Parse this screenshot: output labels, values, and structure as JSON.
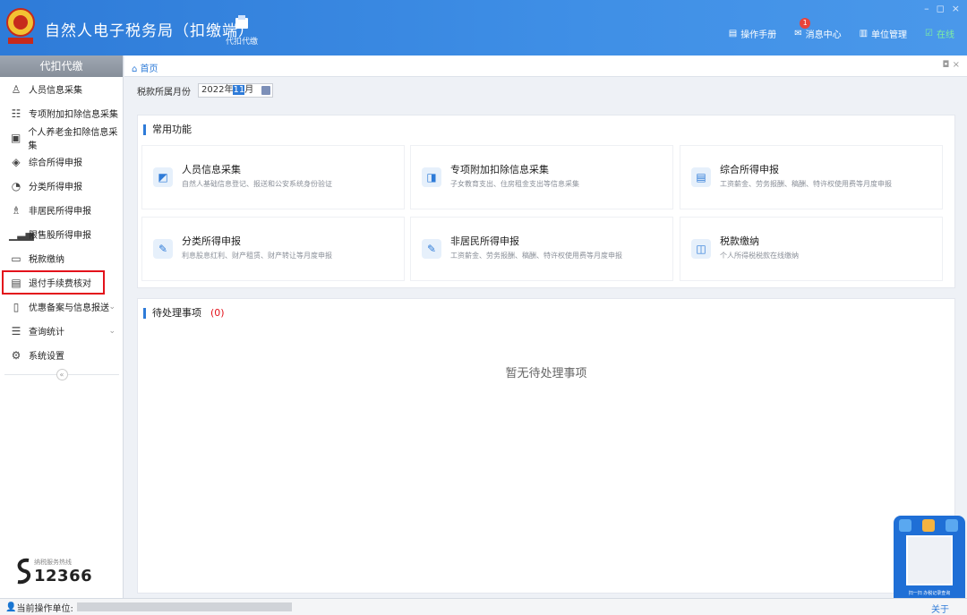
{
  "header": {
    "app_title": "自然人电子税务局（扣缴端）",
    "module_label": "代扣代缴",
    "right_items": [
      {
        "label": "操作手册",
        "icon": "manual-icon"
      },
      {
        "label": "消息中心",
        "icon": "message-icon",
        "badge": "1"
      },
      {
        "label": "单位管理",
        "icon": "company-icon"
      },
      {
        "label": "在线",
        "icon": "online-icon"
      }
    ],
    "window_controls": {
      "minimize": "–",
      "restore": "◻",
      "close": "×"
    }
  },
  "sidebar": {
    "title": "代扣代缴",
    "items": [
      {
        "label": "人员信息采集",
        "icon": "person-icon"
      },
      {
        "label": "专项附加扣除信息采集",
        "icon": "list-icon"
      },
      {
        "label": "个人养老金扣除信息采集",
        "icon": "pension-icon"
      },
      {
        "label": "综合所得申报",
        "icon": "layers-icon"
      },
      {
        "label": "分类所得申报",
        "icon": "pie-icon"
      },
      {
        "label": "非居民所得申报",
        "icon": "user-outline-icon"
      },
      {
        "label": "限售股所得申报",
        "icon": "bar-chart-icon"
      },
      {
        "label": "税款缴纳",
        "icon": "folder-icon"
      },
      {
        "label": "退付手续费核对",
        "icon": "document-icon",
        "highlighted": true
      },
      {
        "label": "优惠备案与信息报送",
        "icon": "file-icon",
        "expandable": true
      },
      {
        "label": "查询统计",
        "icon": "search-list-icon",
        "expandable": true
      },
      {
        "label": "系统设置",
        "icon": "gear-icon"
      }
    ],
    "hotline_label": "纳税服务热线",
    "hotline_number": "12366"
  },
  "tabs": {
    "home": "首页"
  },
  "period": {
    "label": "税款所属月份",
    "year_part": "2022年",
    "month_part": "11",
    "suffix": "月"
  },
  "common": {
    "title": "常用功能",
    "functions": [
      {
        "title": "人员信息采集",
        "desc": "自然人基础信息登记、报送和公安系统身份验证",
        "icon": "person-card-icon"
      },
      {
        "title": "专项附加扣除信息采集",
        "desc": "子女教育支出、住房租金支出等信息采集",
        "icon": "deduction-icon"
      },
      {
        "title": "综合所得申报",
        "desc": "工资薪金、劳务报酬、稿酬、特许权使用费等月度申报",
        "icon": "report-icon"
      },
      {
        "title": "分类所得申报",
        "desc": "利息股息红利、财产租赁、财产转让等月度申报",
        "icon": "edit-icon"
      },
      {
        "title": "非居民所得申报",
        "desc": "工资薪金、劳务报酬、稿酬、特许权使用费等月度申报",
        "icon": "edit-icon"
      },
      {
        "title": "税款缴纳",
        "desc": "个人所得税税款在线缴纳",
        "icon": "payment-icon"
      }
    ]
  },
  "pending": {
    "title": "待处理事项",
    "count": "(0)",
    "empty_text": "暂无待处理事项"
  },
  "status": {
    "operator_label": "当前操作单位:",
    "about": "关于"
  },
  "float": {
    "caption": "扫一扫 办税记录查询"
  }
}
